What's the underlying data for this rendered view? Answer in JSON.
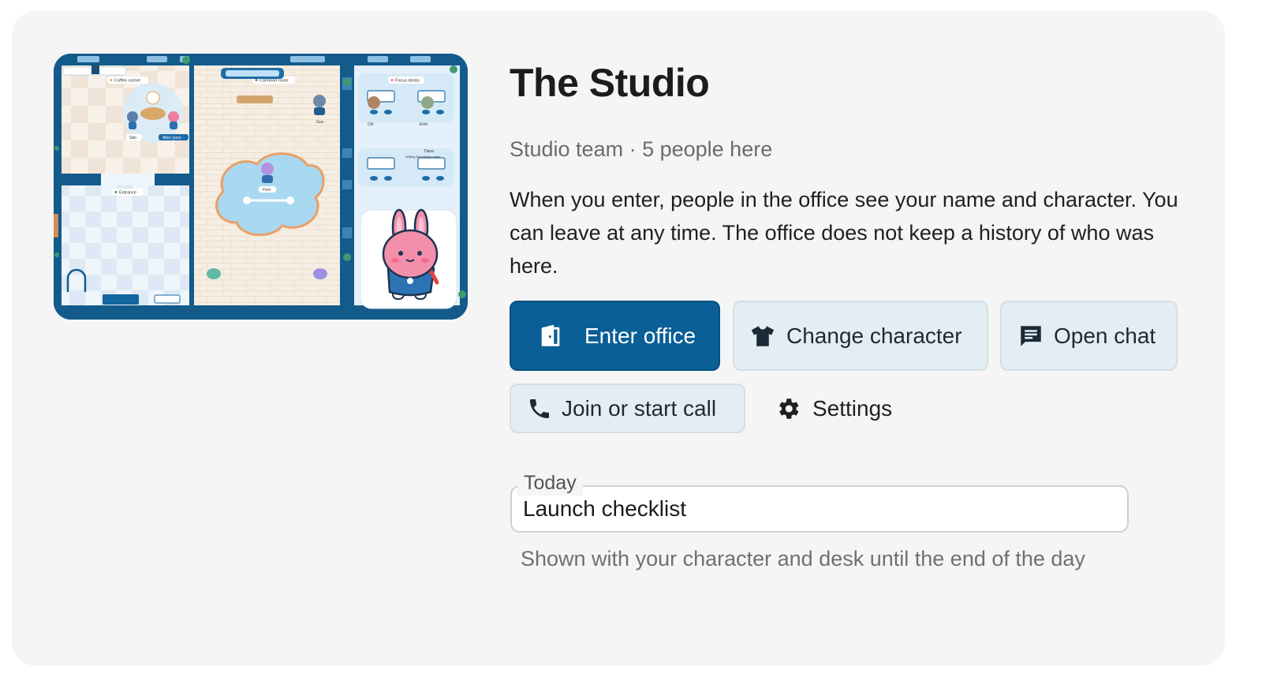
{
  "space": {
    "title": "The Studio",
    "subtitle": "Studio team · 5 people here",
    "description": "When you enter, people in the office see your name and character. You can leave at any time. The office does not keep a history of who was here."
  },
  "preview": {
    "rooms": {
      "coffee_corner": "Coffee corner",
      "common_room": "Common room",
      "focus_desks": "Focus desks",
      "entrance": "Entrance"
    },
    "people": {
      "sao": "São",
      "alice": "Alice (you)",
      "gus": "Gus",
      "fern": "Fern",
      "chi": "Chi",
      "emil": "Emil",
      "dana": "Dana",
      "dana_status": "Writing the release notes"
    }
  },
  "actions": {
    "enter": {
      "label": "Enter office",
      "icon": "door-icon"
    },
    "change_character": {
      "label": "Change character",
      "icon": "shirt-icon"
    },
    "open_chat": {
      "label": "Open chat",
      "icon": "chat-icon"
    },
    "call": {
      "label": "Join or start call",
      "icon": "phone-icon"
    },
    "settings": {
      "label": "Settings",
      "icon": "gear-icon"
    }
  },
  "status": {
    "label": "Today",
    "value": "Launch checklist",
    "helper": "Shown with your character and desk until the end of the day"
  },
  "colors": {
    "primary": "#095f96",
    "secondary_bg": "#e4edf3",
    "card_bg": "#f5f5f5",
    "map_frame": "#135b8a"
  }
}
